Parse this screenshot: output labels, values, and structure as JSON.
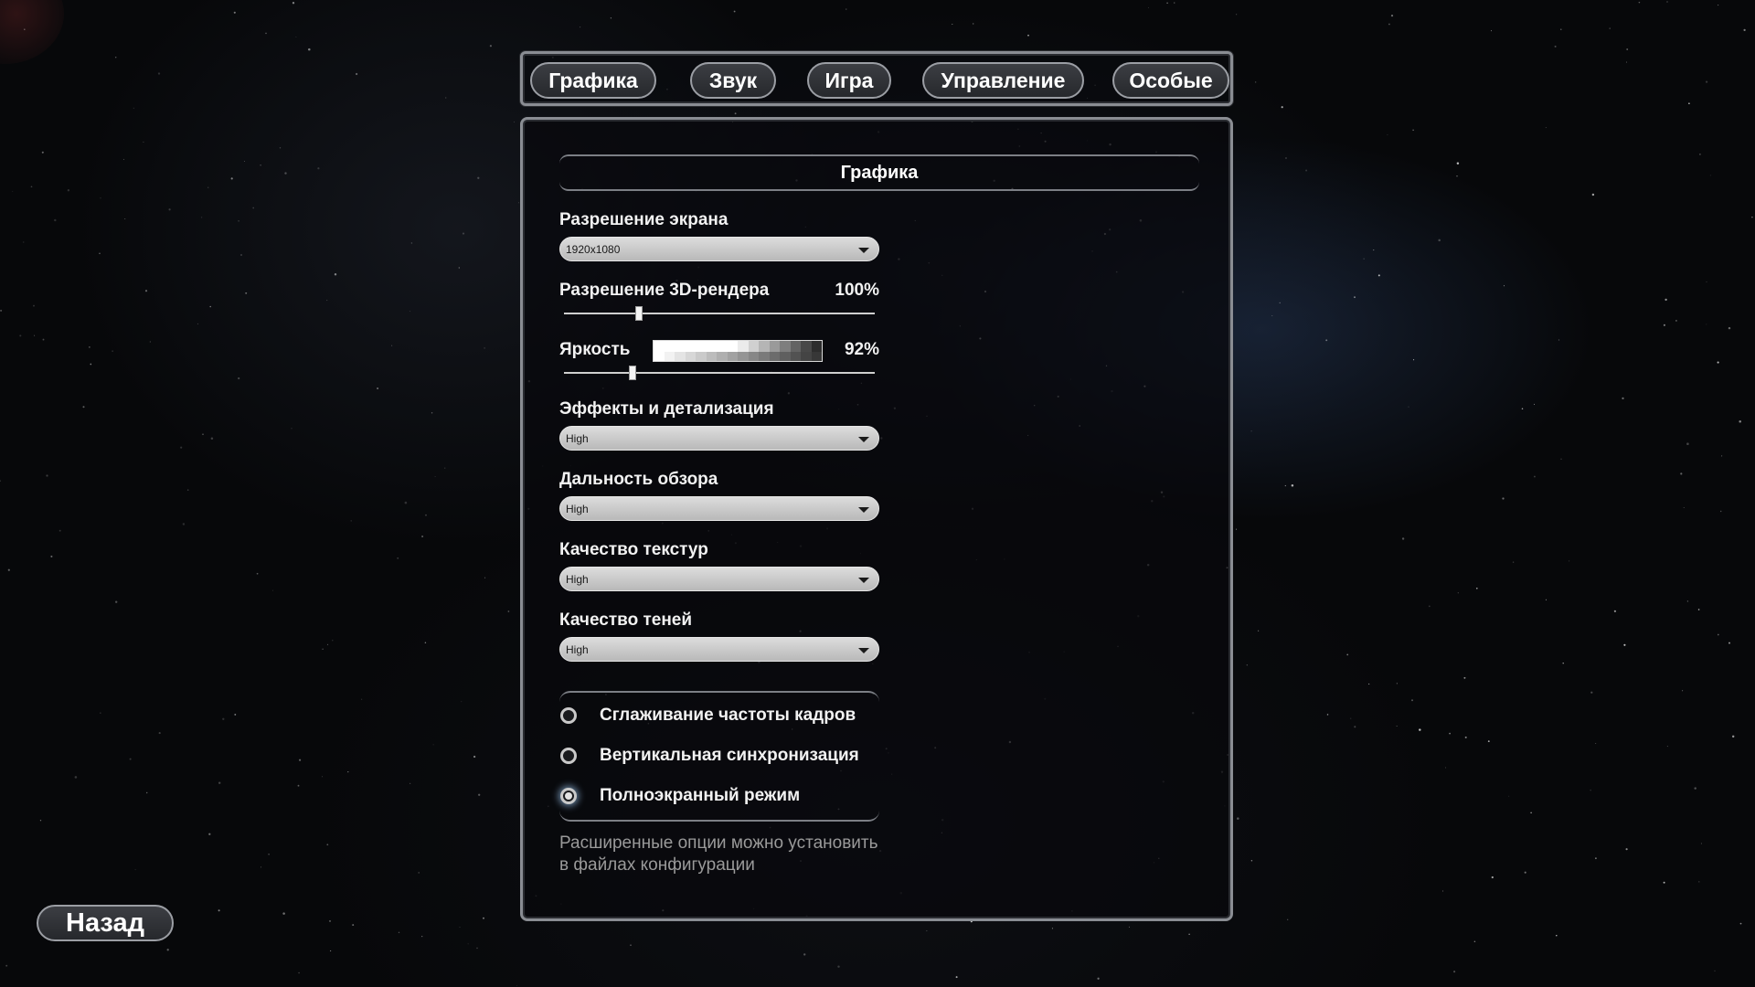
{
  "tabs": [
    {
      "label": "Графика"
    },
    {
      "label": "Звук"
    },
    {
      "label": "Игра"
    },
    {
      "label": "Управление"
    },
    {
      "label": "Особые"
    }
  ],
  "section_title": "Графика",
  "screen_resolution": {
    "label": "Разрешение экрана",
    "value": "1920x1080"
  },
  "render_resolution": {
    "label": "Разрешение 3D-рендера",
    "value": "100%",
    "slider_fraction": 0.24
  },
  "brightness": {
    "label": "Яркость",
    "value": "92%",
    "slider_fraction": 0.22
  },
  "effects": {
    "label": "Эффекты и детализация",
    "value": "High"
  },
  "draw_distance": {
    "label": "Дальность обзора",
    "value": "High"
  },
  "texture_quality": {
    "label": "Качество текстур",
    "value": "High"
  },
  "shadow_quality": {
    "label": "Качество теней",
    "value": "High"
  },
  "options": [
    {
      "label": "Сглаживание частоты кадров",
      "checked": false
    },
    {
      "label": "Вертикальная синхронизация",
      "checked": false
    },
    {
      "label": "Полноэкранный режим",
      "checked": true
    }
  ],
  "note": "Расширенные опции можно установить в файлах конфигурации",
  "back_label": "Назад"
}
